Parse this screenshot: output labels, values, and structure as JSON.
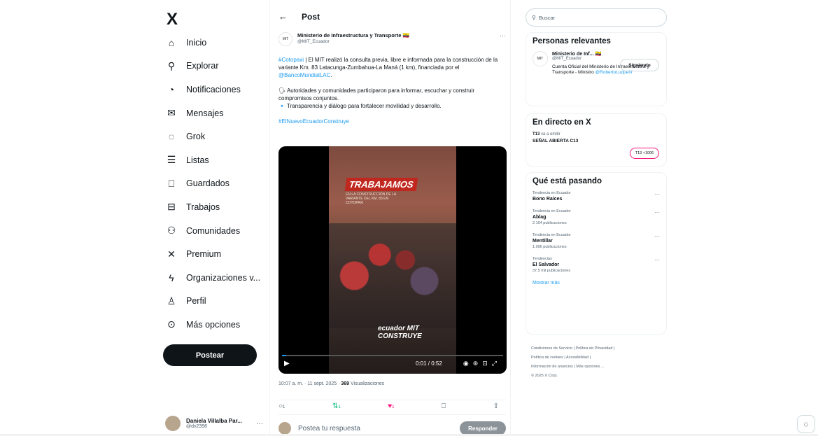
{
  "nav": {
    "logo": "X",
    "items": [
      {
        "label": "Inicio",
        "icon": "home-icon",
        "glyph": "⌂"
      },
      {
        "label": "Explorar",
        "icon": "search-icon",
        "glyph": "⚲"
      },
      {
        "label": "Notificaciones",
        "icon": "bell-icon",
        "glyph": "◔"
      },
      {
        "label": "Mensajes",
        "icon": "mail-icon",
        "glyph": "✉"
      },
      {
        "label": "Grok",
        "icon": "grok-icon",
        "glyph": "◌"
      },
      {
        "label": "Listas",
        "icon": "list-icon",
        "glyph": "☰"
      },
      {
        "label": "Guardados",
        "icon": "bookmark-icon",
        "glyph": "⎕"
      },
      {
        "label": "Trabajos",
        "icon": "briefcase-icon",
        "glyph": "⊟"
      },
      {
        "label": "Comunidades",
        "icon": "communities-icon",
        "glyph": "⚇"
      },
      {
        "label": "Premium",
        "icon": "x-premium-icon",
        "glyph": "✕"
      },
      {
        "label": "Organizaciones v...",
        "icon": "lightning-icon",
        "glyph": "ϟ"
      },
      {
        "label": "Perfil",
        "icon": "person-icon",
        "glyph": "♙"
      },
      {
        "label": "Más opciones",
        "icon": "more-circle-icon",
        "glyph": "⊙"
      }
    ],
    "post_button": "Postear",
    "user": {
      "name": "Daniela Villalba Par...",
      "handle": "@dv2398"
    }
  },
  "main": {
    "header_title": "Post",
    "author": {
      "name": "Ministerio de Infraestructura y Transporte 🇪🇨",
      "handle": "@MIT_Ecuador",
      "avatar_text": "MIT"
    },
    "body": {
      "p1_link1": "#Cotopaxi",
      "p1_text": " | El MIT realizó la consulta previa, libre e informada para la construcción de la variante Km. 83 Latacunga-Zumbahua-La Maná (1 km), financiada por el ",
      "p1_link2": "@BancoMundialLAC",
      "p1_end": ".",
      "p2": "🗣 Autoridades y comunidades participaron para informar, escuchar y construir compromisos conjuntos.",
      "p3": "🔹 Transparencia y diálogo para fortalecer movilidad y desarrollo.",
      "hashtag": "#ElNuevoEcuadorConstruye"
    },
    "video": {
      "headline": "TRABAJAMOS",
      "subhead": "EN LA CONSTRUCCIÓN DE LA VARIANTE DEL KM. 83 EN COTOPAXI",
      "tagline": "ecuador MIT CONSTRUYE",
      "time": "0:01 / 0:52",
      "progress": 0.02
    },
    "meta": {
      "datetime": "10:07 a. m. · 11 sept. 2025 · ",
      "views_count": "369",
      "views_label": " Visualizaciones"
    },
    "actions": {
      "replies": "1",
      "reposts": "1",
      "likes": "1"
    },
    "reply": {
      "placeholder": "Postea tu respuesta",
      "button": "Responder"
    }
  },
  "right": {
    "search_placeholder": "Buscar",
    "relevant": {
      "title": "Personas relevantes",
      "name": "Ministerio de Inf... 🇪🇨",
      "handle": "@MIT_Ecuador",
      "bio": "Cuenta Oficial del Ministerio de Infraestructura y Transporte - Ministro ",
      "bio_link": "@RobertoLuqueN",
      "follow_button": "Siguiendo"
    },
    "live": {
      "title": "En directo en X",
      "by_prefix": "",
      "by_name": "T13",
      "by_suffix": " va a emitir",
      "stream": "SEÑAL ABIERTA C13",
      "badge": "T13 +1006"
    },
    "trending": {
      "title": "Qué está pasando",
      "items": [
        {
          "context": "Tendencia en Ecuador",
          "name": "Bono Raíces",
          "count": ""
        },
        {
          "context": "Tendencia en Ecuador",
          "name": "Ablag",
          "count": "2.104 publicaciones"
        },
        {
          "context": "Tendencia en Ecuador",
          "name": "Mentillar",
          "count": "1.096 publicaciones"
        },
        {
          "context": "Tendencias",
          "name": "El Salvador",
          "count": "37,5 mil publicaciones"
        }
      ],
      "show_more": "Mostrar más"
    },
    "footer": [
      "Condiciones de Servicio  |  Política de Privacidad  |",
      "Política de cookies  |  Accesibilidad  |",
      "Información de anuncios  |  Más opciones ...",
      "© 2025 X Corp."
    ]
  }
}
